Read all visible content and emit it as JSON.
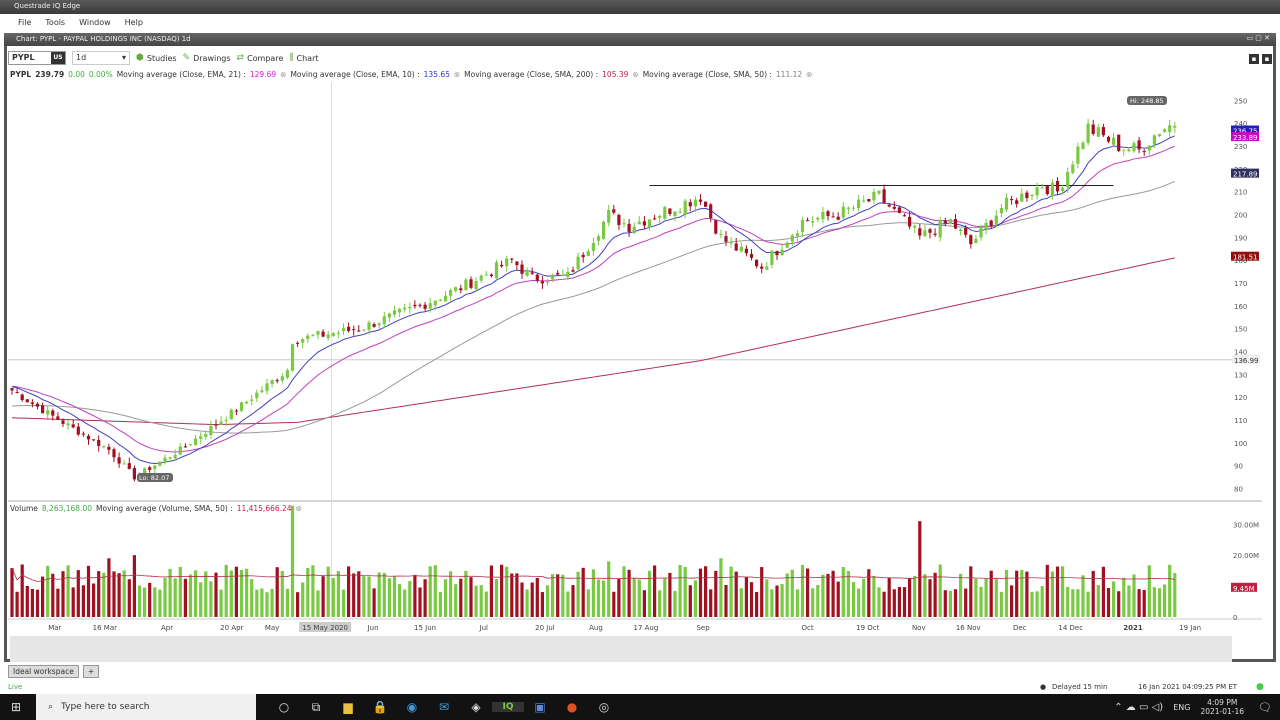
{
  "app": {
    "title": "Questrade IQ Edge",
    "menu": [
      "File",
      "Tools",
      "Window",
      "Help"
    ],
    "window_title": "Chart: PYPL - PAYPAL HOLDINGS INC (NASDAQ) 1d"
  },
  "toolbar": {
    "symbol": "PYPL",
    "symbol_badge": "US",
    "timeframe": "1d",
    "studies": "Studies",
    "drawings": "Drawings",
    "compare": "Compare",
    "chart": "Chart"
  },
  "legend": {
    "symbol": "PYPL",
    "price": "239.79",
    "change": "0.00",
    "change_pct": "0.00%",
    "mas": [
      {
        "label": "Moving average (Close, EMA, 21) :",
        "value": "129.69",
        "color": "#d020d0"
      },
      {
        "label": "Moving average (Close, EMA, 10) :",
        "value": "135.65",
        "color": "#3030d0"
      },
      {
        "label": "Moving average (Close, SMA, 200) :",
        "value": "105.39",
        "color": "#c02040"
      },
      {
        "label": "Moving average (Close, SMA, 50) :",
        "value": "111.12",
        "color": "#808080"
      }
    ]
  },
  "volume_legend": {
    "label": "Volume",
    "value": "8,263,168.00",
    "ma_label": "Moving average (Volume, SMA, 50) :",
    "ma_value": "11,415,666.24"
  },
  "price_badges": [
    {
      "text": "236.75",
      "price": 236.75,
      "color": "#2020c0"
    },
    {
      "text": "233.89",
      "price": 233.89,
      "color": "#c010c0"
    },
    {
      "text": "217.89",
      "price": 217.89,
      "color": "#303060"
    },
    {
      "text": "181.51",
      "price": 181.51,
      "color": "#901010"
    }
  ],
  "crosshair": {
    "price_label": "136.99",
    "price": 136.4,
    "date_label": "15 May 2020",
    "day": 65
  },
  "hi_label": "Hi: 248.85",
  "lo_label": "Lo: 82.07",
  "volume_axis": [
    "30.00M",
    "20.00M",
    "0"
  ],
  "volume_badge": "9.45M",
  "chart_data": {
    "type": "candlestick",
    "num_days": 229,
    "close_waypoints": [
      [
        0,
        123
      ],
      [
        7,
        113
      ],
      [
        19,
        97
      ],
      [
        24,
        85
      ],
      [
        33,
        97
      ],
      [
        43,
        113
      ],
      [
        54,
        132
      ],
      [
        55,
        145
      ],
      [
        68,
        150
      ],
      [
        80,
        160
      ],
      [
        88,
        168
      ],
      [
        98,
        180
      ],
      [
        102,
        172
      ],
      [
        109,
        173
      ],
      [
        117,
        200
      ],
      [
        121,
        195
      ],
      [
        135,
        208
      ],
      [
        139,
        190
      ],
      [
        147,
        177
      ],
      [
        155,
        197
      ],
      [
        162,
        200
      ],
      [
        170,
        208
      ],
      [
        178,
        190
      ],
      [
        184,
        197
      ],
      [
        188,
        187
      ],
      [
        194,
        203
      ],
      [
        202,
        213
      ],
      [
        205,
        210
      ],
      [
        211,
        238
      ],
      [
        217,
        230
      ],
      [
        221,
        228
      ],
      [
        225,
        237
      ],
      [
        228,
        240
      ]
    ],
    "sma200_waypoints": [
      [
        0,
        111
      ],
      [
        40,
        108
      ],
      [
        56,
        109
      ],
      [
        135,
        136
      ],
      [
        228,
        181
      ]
    ],
    "resistance": {
      "price": 212.7,
      "from_day": 125,
      "to_day": 216
    },
    "yticks": [
      250,
      240,
      230,
      220,
      210,
      200,
      190,
      180,
      170,
      160,
      150,
      140,
      130,
      120,
      110,
      100,
      90,
      80
    ],
    "ylim": [
      75,
      258
    ],
    "volume_spikes": [
      [
        55,
        36
      ],
      [
        178,
        31
      ],
      [
        24,
        20
      ],
      [
        19,
        19
      ],
      [
        139,
        19
      ],
      [
        117,
        18
      ],
      [
        182,
        17
      ]
    ],
    "volume_ylim": [
      0,
      33
    ],
    "xticks": [
      [
        "Mar",
        8.4
      ],
      [
        "16 Mar",
        18.2
      ],
      [
        "Apr",
        30.4
      ],
      [
        "20 Apr",
        43.1
      ],
      [
        "May",
        51
      ],
      [
        "15 May 2020",
        61.4
      ],
      [
        "Jun",
        70.8
      ],
      [
        "15 Jun",
        81
      ],
      [
        "Jul",
        92.5
      ],
      [
        "20 Jul",
        104.5
      ],
      [
        "Aug",
        114.5
      ],
      [
        "17 Aug",
        124.3
      ],
      [
        "Sep",
        135.5
      ],
      [
        "Oct",
        156
      ],
      [
        "19 Oct",
        167.8
      ],
      [
        "Nov",
        177.8
      ],
      [
        "16 Nov",
        187.5
      ],
      [
        "Dec",
        197.6
      ],
      [
        "14 Dec",
        207.6
      ],
      [
        "2021",
        219.8
      ],
      [
        "19 Jan",
        231
      ]
    ]
  },
  "workspace": {
    "tab": "Ideal workspace",
    "add": "+"
  },
  "status": {
    "live": "Live",
    "delayed": "Delayed 15 min",
    "datetime": "16 Jan 2021 04:09:25 PM ET"
  },
  "taskbar": {
    "search": "Type here to search",
    "time": "4:09 PM",
    "date": "2021-01-16",
    "lang": "ENG"
  }
}
